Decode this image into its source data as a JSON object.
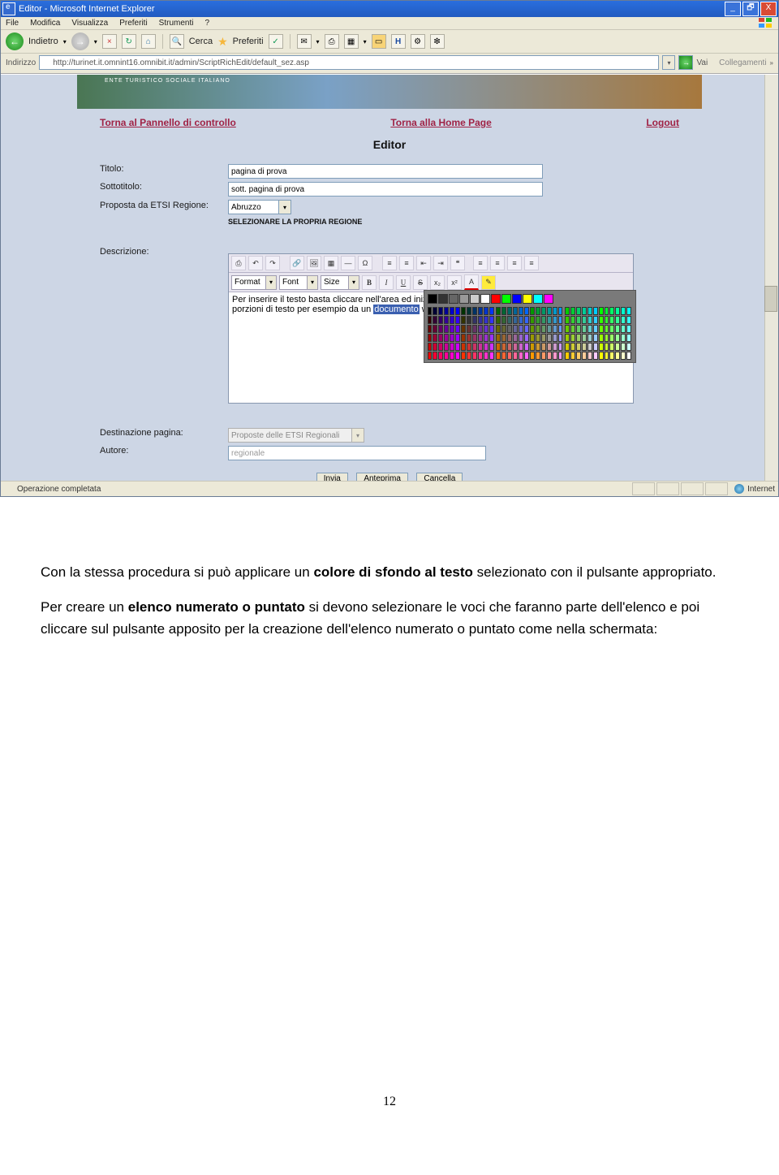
{
  "window": {
    "title": "Editor - Microsoft Internet Explorer",
    "menus": [
      "File",
      "Modifica",
      "Visualizza",
      "Preferiti",
      "Strumenti",
      "?"
    ],
    "back_label": "Indietro",
    "search_label": "Cerca",
    "fav_label": "Preferiti",
    "addr_label": "Indirizzo",
    "url": "http://turinet.it.omnint16.omnibit.it/admin/ScriptRichEdit/default_sez.asp",
    "go_label": "Vai",
    "links_label": "Collegamenti",
    "status_left": "Operazione completata",
    "status_zone": "Internet"
  },
  "page": {
    "banner_text": "ENTE TURISTICO SOCIALE ITALIANO",
    "nav": {
      "panel": "Torna al Pannello di controllo",
      "home": "Torna alla Home Page",
      "logout": "Logout"
    },
    "heading": "Editor",
    "labels": {
      "titolo": "Titolo:",
      "sottotitolo": "Sottotitolo:",
      "proposta": "Proposta da ETSI Regione:",
      "descrizione": "Descrizione:",
      "destinazione": "Destinazione pagina:",
      "autore": "Autore:"
    },
    "values": {
      "titolo": "pagina di prova",
      "sottotitolo": "sott. pagina di prova",
      "regione": "Abruzzo",
      "regione_help": "SELEZIONARE LA PROPRIA REGIONE",
      "destinazione": "Proposte delle ETSI Regionali",
      "autore": "regionale"
    },
    "rte": {
      "format": "Format",
      "font": "Font",
      "size": "Size",
      "line1_a": "Per inserire il testo basta cliccare nell'area ed inizi",
      "line1_b": "e",
      "line2_a": "porzioni di testo per esempio da un ",
      "line2_hl": "documento",
      "line2_b": " wo"
    },
    "buttons": {
      "invia": "Invia",
      "anteprima": "Anteprima",
      "cancella": "Cancella"
    }
  },
  "doc": {
    "p1_a": "Con la stessa procedura si può applicare un ",
    "p1_b": "colore di sfondo al testo",
    "p1_c": " selezionato con il pulsante appropriato.",
    "p2_a": "Per creare un ",
    "p2_b": "elenco numerato o puntato",
    "p2_c": " si devono selezionare le voci che faranno parte dell'elenco e poi cliccare sul pulsante apposito per la creazione dell'elenco numerato o puntato come nella schermata:",
    "pagenum": "12"
  },
  "palette_top": [
    "#000000",
    "#333333",
    "#666666",
    "#999999",
    "#cccccc",
    "#ffffff",
    "#ff0000",
    "#00ff00",
    "#0000ff",
    "#ffff00",
    "#00ffff",
    "#ff00ff"
  ]
}
